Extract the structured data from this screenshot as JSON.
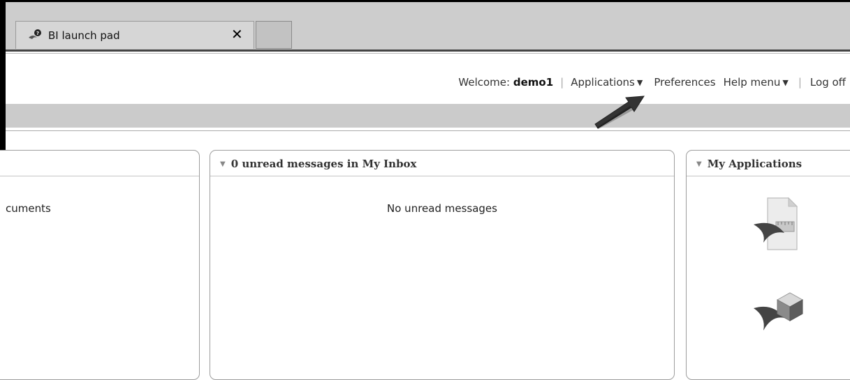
{
  "browser": {
    "tab": {
      "title": "BI launch pad",
      "icon": "bi-launchpad-icon",
      "close_icon": "✕"
    }
  },
  "header": {
    "welcome_label": "Welcome:",
    "username": "demo1",
    "applications_label": "Applications",
    "preferences_label": "Preferences",
    "help_label": "Help menu",
    "logoff_label": "Log off"
  },
  "panels": {
    "left": {
      "partial_text": "cuments"
    },
    "inbox": {
      "title": "0 unread messages in My Inbox",
      "empty_text": "No unread messages"
    },
    "apps": {
      "title": "My Applications",
      "items": [
        "web-intelligence-icon",
        "cube-app-icon"
      ]
    }
  },
  "colors": {
    "accent_arrow": "#333333",
    "bar": "#cbcbcb"
  }
}
